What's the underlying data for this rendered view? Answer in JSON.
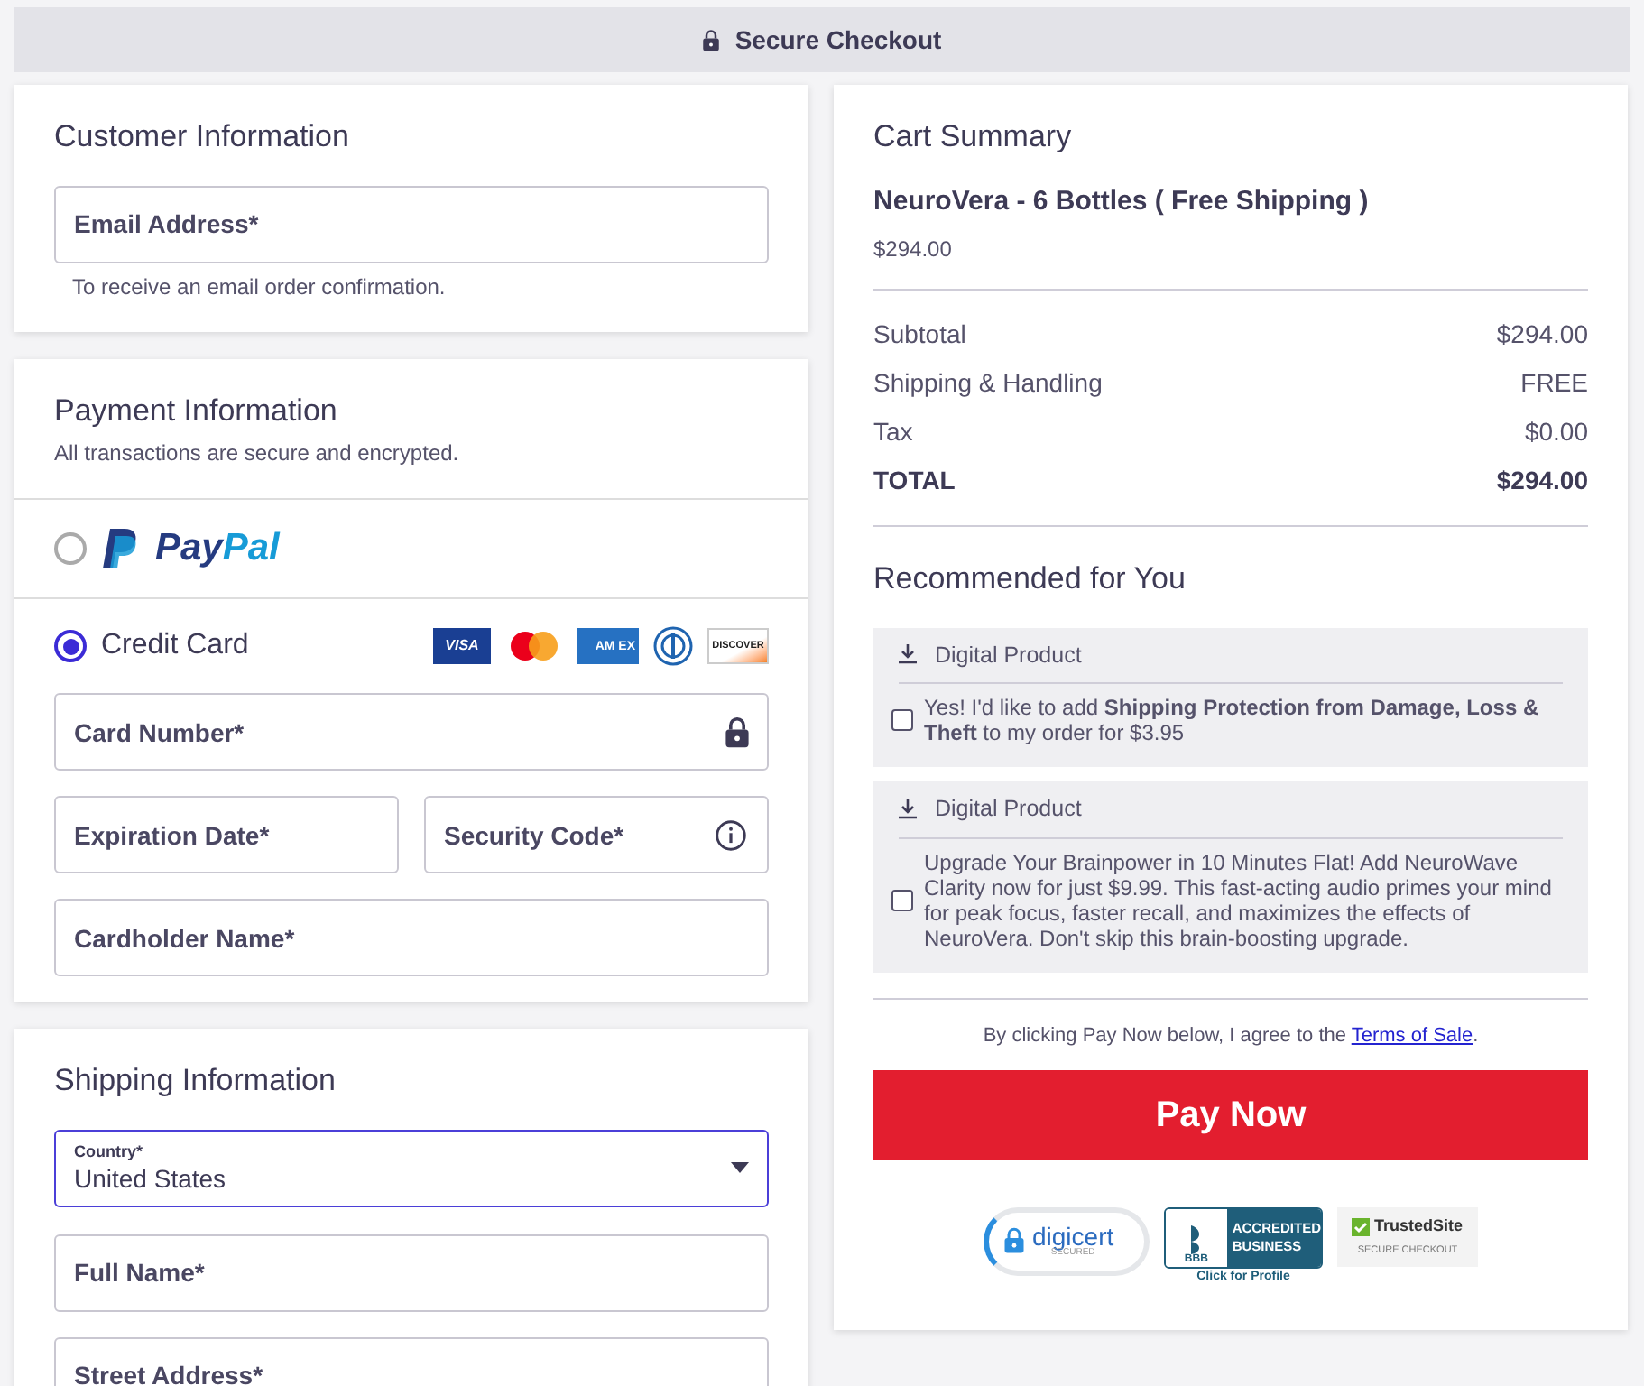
{
  "header": {
    "title": "Secure Checkout"
  },
  "customer": {
    "title": "Customer Information",
    "email": {
      "placeholder": "Email Address*"
    },
    "hint": "To receive an email order confirmation."
  },
  "payment": {
    "title": "Payment Information",
    "subtitle": "All transactions are secure and encrypted.",
    "methods": [
      {
        "kind": "paypal",
        "label": "PayPal",
        "selected": false
      },
      {
        "kind": "card",
        "label": "Credit Card",
        "selected": true,
        "brands": [
          {
            "kind": "visa",
            "text": "VISA"
          },
          {
            "kind": "mastercard"
          },
          {
            "kind": "amex",
            "text": "AM EX"
          },
          {
            "kind": "diners"
          },
          {
            "kind": "discover",
            "text": "DISCOVER"
          }
        ]
      }
    ],
    "fields": [
      {
        "kind": "lock",
        "placeholder": "Card Number*"
      },
      {
        "kind": "pair",
        "items": [
          {
            "placeholder": "Expiration Date*"
          },
          {
            "placeholder": "Security Code*",
            "kind": "info"
          }
        ]
      },
      {
        "kind": "plain",
        "placeholder": "Cardholder Name*"
      }
    ]
  },
  "shipping": {
    "title": "Shipping Information",
    "country": {
      "label": "Country*",
      "value": "United States"
    },
    "fields": [
      {
        "placeholder": "Full Name*"
      },
      {
        "placeholder": "Street Address*"
      }
    ]
  },
  "cart": {
    "title": "Cart Summary",
    "product": "NeuroVera - 6 Bottles ( Free Shipping )",
    "price": "$294.00",
    "lines": [
      {
        "label": "Subtotal",
        "value": "$294.00",
        "total": false
      },
      {
        "label": "Shipping & Handling",
        "value": "FREE",
        "total": false
      },
      {
        "label": "Tax",
        "value": "$0.00",
        "total": false
      },
      {
        "label": "TOTAL",
        "value": "$294.00",
        "total": true
      }
    ]
  },
  "recommended": {
    "title": "Recommended for You",
    "items": [
      {
        "tag": "Digital Product",
        "text": "Yes! I'd like to add **Shipping Protection from Damage, Loss & Theft** to my order for $3.95",
        "checked": false
      },
      {
        "tag": "Digital Product",
        "text": "Upgrade Your Brainpower in 10 Minutes Flat! Add NeuroWave Clarity now for just $9.99. This fast-acting audio primes your mind for peak focus, faster recall, and maximizes the effects of NeuroVera. Don't skip this brain-boosting upgrade.",
        "checked": false
      }
    ]
  },
  "agreement": {
    "text": "By clicking Pay Now below, I agree to the",
    "link": "Terms of Sale",
    "end": "."
  },
  "pay_button": "Pay Now",
  "badges": {
    "digicert": {
      "name": "digicert",
      "sub": "SECURED"
    },
    "bbb": {
      "mark": "BBB",
      "line1": "ACCREDITED",
      "line2": "BUSINESS",
      "link": "Click for Profile"
    },
    "trusted": {
      "name": "TrustedSite",
      "sub": "SECURE CHECKOUT"
    }
  }
}
